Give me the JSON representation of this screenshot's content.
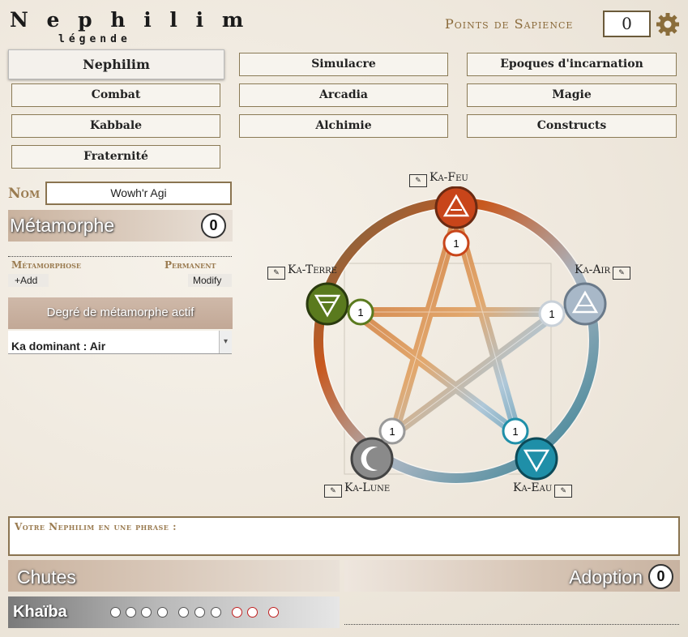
{
  "logo": {
    "title": "N e p h i l i m",
    "subtitle": "légende"
  },
  "points": {
    "label": "Points de Sapience",
    "value": "0"
  },
  "tabs": [
    {
      "label": "Nephilim"
    },
    {
      "label": "Simulacre"
    },
    {
      "label": "Epoques d'incarnation"
    },
    {
      "label": "Combat"
    },
    {
      "label": "Arcadia"
    },
    {
      "label": "Magie"
    },
    {
      "label": "Kabbale"
    },
    {
      "label": "Alchimie"
    },
    {
      "label": "Constructs"
    },
    {
      "label": "Fraternité"
    }
  ],
  "nom": {
    "label": "Nom",
    "value": "Wowh'r Agi"
  },
  "metamorphe": {
    "title": "Métamorphe",
    "count": "0",
    "col_left": "Métamorphose",
    "col_right": "Permanent",
    "add_label": "+Add",
    "modify_label": "Modify",
    "degre_label": "Degré de métamorphe actif",
    "ka_dominant": "Ka dominant : Air"
  },
  "pentacle": {
    "feu": {
      "label": "Ka-Feu",
      "value": "1",
      "color": "#c8451a"
    },
    "air": {
      "label": "Ka-Air",
      "value": "1",
      "color": "#a8b8c8"
    },
    "eau": {
      "label": "Ka-Eau",
      "value": "1",
      "color": "#1f8fa8"
    },
    "lune": {
      "label": "Ka-Lune",
      "value": "1",
      "color": "#8a8a8a"
    },
    "terre": {
      "label": "Ka-Terre",
      "value": "1",
      "color": "#5a7a1e"
    }
  },
  "phrase": {
    "label": "Votre Nephilim en une phrase :"
  },
  "chutes": {
    "title": "Chutes"
  },
  "adoption": {
    "title": "Adoption",
    "count": "0"
  },
  "khaiba": {
    "label": "Khaïba",
    "dots": 9,
    "filled_white": 6
  }
}
